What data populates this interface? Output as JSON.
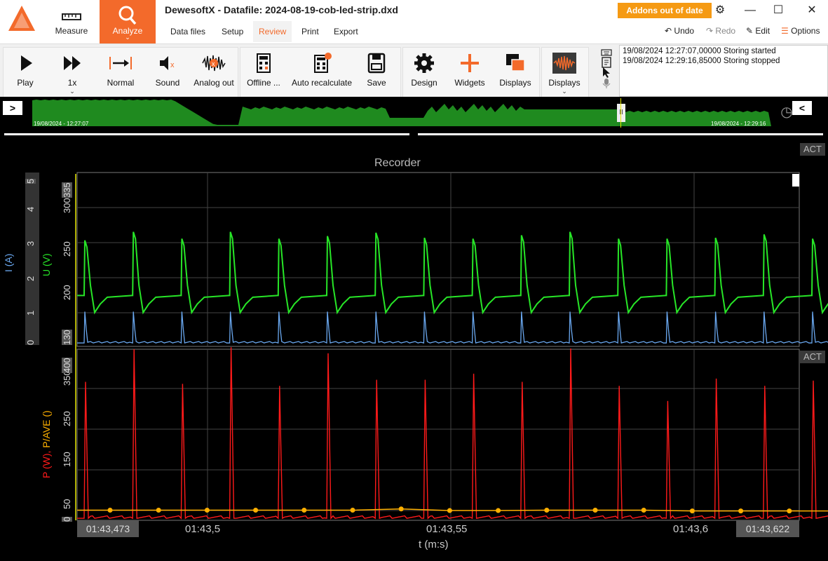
{
  "app": {
    "title": "DewesoftX - Datafile: 2024-08-19-cob-led-strip.dxd",
    "modes": [
      {
        "label": "Measure"
      },
      {
        "label": "Analyze"
      }
    ],
    "tabs": [
      "Data files",
      "Setup",
      "Review",
      "Print",
      "Export"
    ],
    "active_tab": "Review",
    "addons_badge": "Addons out of date",
    "right_tools": {
      "undo": "Undo",
      "redo": "Redo",
      "edit": "Edit",
      "options": "Options"
    }
  },
  "toolbar": {
    "play": "Play",
    "speed": "1x",
    "normal": "Normal",
    "sound": "Sound",
    "analog_out": "Analog out",
    "offline": "Offline ...",
    "auto_recalc": "Auto recalculate",
    "save": "Save",
    "design": "Design",
    "widgets": "Widgets",
    "displays_a": "Displays",
    "displays_b": "Displays"
  },
  "event_log": [
    "19/08/2024 12:27:07,00000 Storing started",
    "19/08/2024 12:29:16,85000 Storing stopped"
  ],
  "overview": {
    "start": "19/08/2024 - 12:27:07",
    "end": "19/08/2024 - 12:29:16",
    "nav_left": ">",
    "nav_right": "<",
    "pause_marker": "II"
  },
  "colors": {
    "accent": "#f36a2b",
    "voltage": "#27e627",
    "current": "#6aa8f0",
    "power": "#ff1a1a",
    "power_avg": "#ffb000",
    "overview_fill": "#1f8a1f"
  },
  "recorder": {
    "title": "Recorder",
    "act": "ACT",
    "current_label": "I (A)",
    "voltage_label": "U (V)",
    "current_ticks": [
      "0",
      "1",
      "2",
      "3",
      "4",
      "5"
    ],
    "voltage_ticks": [
      "130",
      "200",
      "250",
      "300",
      "335"
    ]
  },
  "power_panel": {
    "act": "ACT",
    "ylabel_p": "P (W),",
    "ylabel_pave": "P/AVE ()",
    "ticks": [
      "0",
      "50",
      "150",
      "250",
      "350",
      "400"
    ]
  },
  "x_axis": {
    "label": "t (m:s)",
    "start": "01:43,473",
    "end": "01:43,622",
    "ticks": [
      "01:43,5",
      "01:43,55",
      "01:43,6"
    ]
  },
  "chart_data": [
    {
      "type": "line",
      "title": "Recorder",
      "xlabel": "t (m:s)",
      "xlim": [
        "01:43,473",
        "01:43,622"
      ],
      "series": [
        {
          "name": "U (V)",
          "axis_range": [
            130,
            335
          ],
          "baseline": 190,
          "valley": 170,
          "peaks": [
            255,
            265,
            257,
            265,
            257,
            260,
            264,
            258,
            257,
            261,
            265,
            257,
            257,
            258,
            262,
            257
          ]
        },
        {
          "name": "I (A)",
          "axis_range": [
            0,
            5
          ],
          "baseline": 0.1,
          "peaks": [
            1.0,
            1.0,
            1.0,
            1.0,
            1.0,
            1.0,
            1.0,
            1.0,
            1.0,
            1.0,
            1.0,
            1.0,
            1.0,
            1.0,
            1.0,
            1.0
          ]
        }
      ]
    },
    {
      "type": "line",
      "xlabel": "t (m:s)",
      "xlim": [
        "01:43,473",
        "01:43,622"
      ],
      "series": [
        {
          "name": "P (W)",
          "axis_range": [
            0,
            420
          ],
          "baseline": 5,
          "peaks": [
            340,
            420,
            335,
            425,
            330,
            410,
            345,
            345,
            360,
            340,
            422,
            330,
            293,
            348,
            330,
            343
          ]
        },
        {
          "name": "P/AVE ()",
          "axis_range": [
            0,
            420
          ],
          "values": [
            25,
            25,
            25,
            25,
            25,
            25,
            28,
            24,
            24,
            25,
            25,
            25,
            23,
            23,
            23,
            23
          ]
        }
      ]
    }
  ]
}
